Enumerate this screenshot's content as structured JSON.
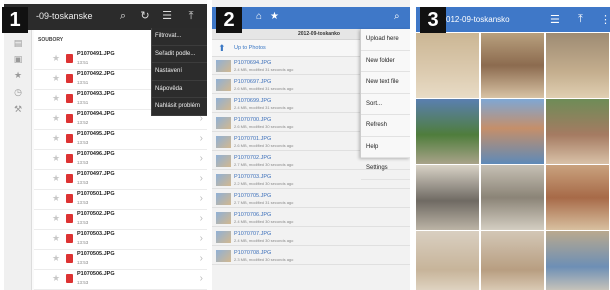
{
  "panel1": {
    "badge": "1",
    "title": "-09-toskanske",
    "toolbar_icons": [
      "search-icon",
      "refresh-icon",
      "sort-icon",
      "upload-icon"
    ],
    "sidebar_icons": [
      "folder-icon",
      "storage-icon",
      "star-icon",
      "history-icon",
      "settings-icon"
    ],
    "list_header": "SOUBORY",
    "files": [
      {
        "name": "P1070491.JPG",
        "time": "13:51"
      },
      {
        "name": "P1070492.JPG",
        "time": "13:51"
      },
      {
        "name": "P1070493.JPG",
        "time": "13:51"
      },
      {
        "name": "P1070494.JPG",
        "time": "13:52"
      },
      {
        "name": "P1070495.JPG",
        "time": "13:53"
      },
      {
        "name": "P1070496.JPG",
        "time": "13:53"
      },
      {
        "name": "P1070497.JPG",
        "time": "13:53"
      },
      {
        "name": "P1070501.JPG",
        "time": "13:53"
      },
      {
        "name": "P1070502.JPG",
        "time": "13:53"
      },
      {
        "name": "P1070503.JPG",
        "time": "13:53"
      },
      {
        "name": "P1070505.JPG",
        "time": "13:53"
      },
      {
        "name": "P1070506.JPG",
        "time": "13:53"
      }
    ],
    "menu": [
      "Filtrovat...",
      "Seřadit podle...",
      "Nastavení",
      "Nápověda",
      "Nahlásit problém"
    ]
  },
  "panel2": {
    "badge": "2",
    "path": "2012-09-toskanko",
    "up_label": "Up to Photos",
    "files": [
      {
        "name": "P1070694.JPG",
        "meta": "2.4 MB, modified 31 seconds ago"
      },
      {
        "name": "P1070697.JPG",
        "meta": "2.6 MB, modified 31 seconds ago"
      },
      {
        "name": "P1070699.JPG",
        "meta": "2.4 MB, modified 31 seconds ago"
      },
      {
        "name": "P1070700.JPG",
        "meta": "2.6 MB, modified 30 seconds ago"
      },
      {
        "name": "P1070701.JPG",
        "meta": "2.6 MB, modified 30 seconds ago"
      },
      {
        "name": "P1070702.JPG",
        "meta": "2.7 MB, modified 30 seconds ago"
      },
      {
        "name": "P1070703.JPG",
        "meta": "2.2 MB, modified 30 seconds ago"
      },
      {
        "name": "P1070705.JPG",
        "meta": "2.7 MB, modified 31 seconds ago"
      },
      {
        "name": "P1070706.JPG",
        "meta": "2.4 MB, modified 30 seconds ago"
      },
      {
        "name": "P1070707.JPG",
        "meta": "2.4 MB, modified 30 seconds ago"
      },
      {
        "name": "P1070708.JPG",
        "meta": "2.3 MB, modified 30 seconds ago"
      }
    ],
    "menu": [
      "Upload here",
      "New folder",
      "New text file",
      "Sort...",
      "Refresh",
      "Help",
      "Settings"
    ]
  },
  "panel3": {
    "badge": "3",
    "title": "012-09-toskansko",
    "toolbar_icons": [
      "list-view-icon",
      "upload-icon",
      "menu-overflow-icon"
    ],
    "photos": [
      {
        "name": "beach-child-photo",
        "bg": "linear-gradient(180deg,#cbb694 0%,#dccbb0 60%,#e8dcc6 100%)"
      },
      {
        "name": "family-beach-photo",
        "bg": "linear-gradient(180deg,#b8a07e 0%,#8c6b4f 50%,#d8c3a5 100%)"
      },
      {
        "name": "child-sand-photo",
        "bg": "linear-gradient(180deg,#9d8b73 0%,#c4ae8e 60%,#e0cfb2 100%)"
      },
      {
        "name": "palm-garden-photo",
        "bg": "linear-gradient(180deg,#5a7fb0 0%,#4f7d3c 55%,#a9a38a 100%)"
      },
      {
        "name": "hotel-pool-photo",
        "bg": "linear-gradient(180deg,#7fa7d4 0%,#c58f6a 45%,#5e8ab8 100%)"
      },
      {
        "name": "mother-child-photo",
        "bg": "linear-gradient(180deg,#6e8c57 0%,#a57b62 55%,#d9c2a8 100%)"
      },
      {
        "name": "stroller-photo",
        "bg": "linear-gradient(180deg,#d8d2c6 0%,#6f6a63 55%,#bcb4a6 100%)"
      },
      {
        "name": "street-walk-photo",
        "bg": "linear-gradient(180deg,#c6c0b4 0%,#8b8477 50%,#d4cec2 100%)"
      },
      {
        "name": "town-square-photo",
        "bg": "linear-gradient(180deg,#c9a27e 0%,#a76a48 50%,#d8c0a0 100%)"
      },
      {
        "name": "baby-beach-photo",
        "bg": "linear-gradient(180deg,#d9cfc1 0%,#c7b49a 60%,#e6dccc 100%)"
      },
      {
        "name": "baby-hat-photo",
        "bg": "linear-gradient(180deg,#d3c7b6 0%,#b89e81 60%,#e3d6c3 100%)"
      },
      {
        "name": "child-blue-photo",
        "bg": "linear-gradient(180deg,#b9a98e 0%,#6d8fb5 55%,#ddd0bb 100%)"
      }
    ]
  },
  "colors": {
    "dark_toolbar": "#2b2b2b",
    "blue_toolbar": "#3f78c8",
    "link_blue": "#3b6fba",
    "file_red": "#dd3333"
  }
}
